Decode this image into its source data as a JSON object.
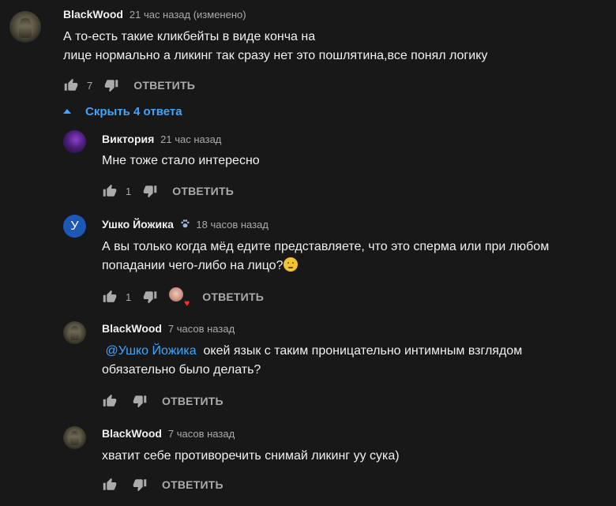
{
  "icons": {
    "like": "thumbs-up-icon",
    "dislike": "thumbs-down-icon",
    "toggle": "caret-up-icon",
    "heart": "heart-icon",
    "emoji": "thinking-face-emoji"
  },
  "colors": {
    "background": "#181818",
    "text": "#f1f1f1",
    "secondary": "#aaaaaa",
    "link": "#3ea6ff",
    "heart": "#ff2b2b"
  },
  "thread": {
    "author": "BlackWood",
    "time": "21 час назад (изменено)",
    "text_line1": "А то-есть такие кликбейты в виде конча на",
    "text_line2": "лице нормально а ликинг так сразу нет это пошлятина,все понял логику",
    "likes": "7",
    "reply_label": "ОТВЕТИТЬ"
  },
  "replies_toggle": "Скрыть 4 ответа",
  "replies": [
    {
      "author": "Виктория",
      "time": "21 час назад",
      "text_line1": "Мне тоже стало интересно",
      "likes": "1",
      "reply_label": "ОТВЕТИТЬ"
    },
    {
      "author": "Ушко Йожика",
      "avatar_letter": "У",
      "time": "18 часов назад",
      "text_line1": "А вы только когда мёд едите представляете, что это сперма или при любом",
      "text_line2": "попадании чего-либо на лицо?",
      "likes": "1",
      "reply_label": "ОТВЕТИТЬ"
    },
    {
      "author": "BlackWood",
      "time": "7 часов назад",
      "mention": "@Ушко Йожика",
      "text_line1": "окей язык с таким проницательно интимным взглядом",
      "text_line2": "обязательно было делать?",
      "reply_label": "ОТВЕТИТЬ"
    },
    {
      "author": "BlackWood",
      "time": "7 часов назад",
      "text_line1": "хватит себе противоречить снимай ликинг уу сука)",
      "reply_label": "ОТВЕТИТЬ"
    }
  ]
}
